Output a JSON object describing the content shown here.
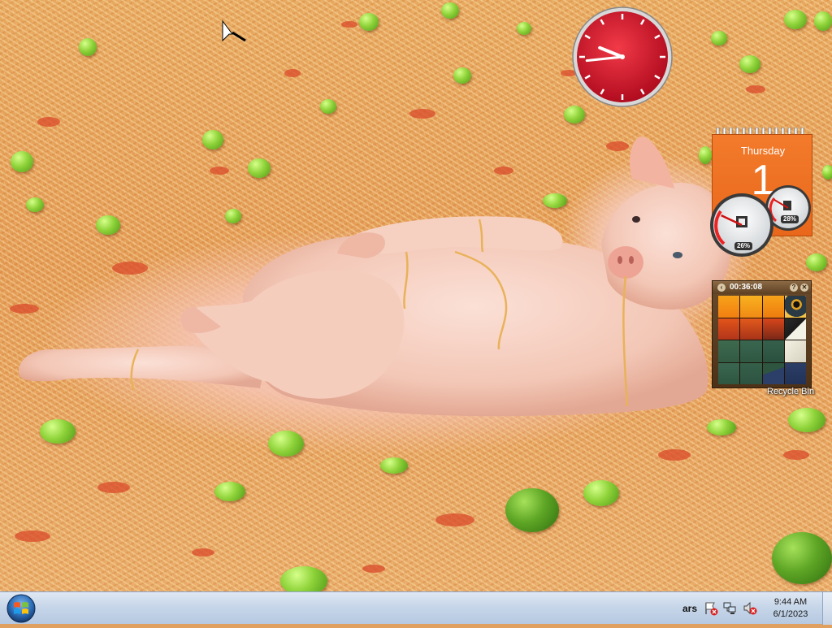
{
  "gadgets": {
    "clock": {
      "hour": 9,
      "minute": 44
    },
    "calendar": {
      "day_name": "Thursday",
      "day_number": "1"
    },
    "cpu_meter": {
      "cpu_label": "26%",
      "memory_label": "28%",
      "cpu_percent": 26,
      "memory_percent": 28
    },
    "puzzle": {
      "timer": "00:36:08",
      "help_label": "?",
      "close_label": "✕",
      "prev_label": "‹"
    }
  },
  "desktop": {
    "recycle_bin_label": "Recycle Bin"
  },
  "taskbar": {
    "language": "ars",
    "time": "9:44 AM",
    "date": "6/1/2023",
    "tray_icons": [
      "action-center-icon",
      "network-icon",
      "volume-muted-icon"
    ]
  },
  "colors": {
    "calendar_orange": "#ef6f22",
    "clock_red": "#c8102e",
    "taskbar": "#c7d6e9"
  }
}
